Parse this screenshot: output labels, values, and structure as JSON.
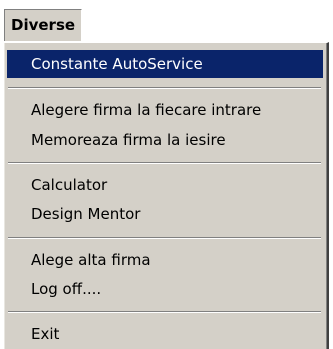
{
  "menu": {
    "title": "Diverse",
    "items": [
      {
        "label": "Constante AutoService",
        "selected": true
      },
      {
        "label": "Alegere firma la fiecare intrare"
      },
      {
        "label": "Memoreaza firma la iesire"
      },
      {
        "label": "Calculator"
      },
      {
        "label": "Design Mentor"
      },
      {
        "label": "Alege alta firma"
      },
      {
        "label": "Log off...."
      },
      {
        "label": "Exit"
      }
    ]
  },
  "colors": {
    "menu_background": "#d4d0c8",
    "selection_background": "#0a246a",
    "selection_text": "#ffffff",
    "separator_dark": "#808080"
  }
}
